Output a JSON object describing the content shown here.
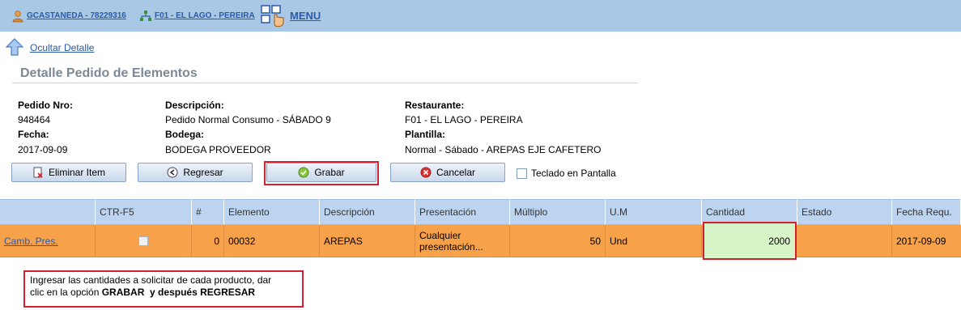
{
  "topbar": {
    "user_label": "GCASTANEDA - 78229316",
    "location_label": "F01 - EL LAGO - PEREIRA",
    "menu_label": "MENU"
  },
  "back": {
    "label": "Ocultar Detalle"
  },
  "section_title": "Detalle Pedido de Elementos",
  "details": {
    "pedido_label": "Pedido Nro:",
    "pedido_value": "948464",
    "fecha_label": "Fecha:",
    "fecha_value": "2017-09-09",
    "descripcion_label": "Descripción:",
    "descripcion_value": "Pedido Normal Consumo - SÁBADO 9",
    "bodega_label": "Bodega:",
    "bodega_value": "BODEGA PROVEEDOR",
    "restaurante_label": "Restaurante:",
    "restaurante_value": "F01 - EL LAGO - PEREIRA",
    "plantilla_label": "Plantilla:",
    "plantilla_value": "Normal - Sábado - AREPAS EJE CAFETERO"
  },
  "buttons": {
    "eliminar": "Eliminar Item",
    "regresar": "Regresar",
    "grabar": "Grabar",
    "cancelar": "Cancelar"
  },
  "teclado_label": "Teclado en Pantalla",
  "table": {
    "headers": [
      "",
      "CTR-F5",
      "#",
      "Elemento",
      "Descripción",
      "Presentación",
      "Múltiplo",
      "U.M",
      "Cantidad",
      "Estado",
      "Fecha Requ."
    ],
    "row": {
      "action": "Camb. Pres.",
      "index": "0",
      "elemento": "00032",
      "descripcion": "AREPAS",
      "presentacion_line1": "Cualquier",
      "presentacion_line2": "presentación...",
      "multiplo": "50",
      "um": "Und",
      "cantidad": "2000",
      "estado": "",
      "fecha": "2017-09-09"
    }
  },
  "note": {
    "line1": "Ingresar las cantidades a solicitar de cada producto, dar",
    "line2_prefix": "clic en la opción ",
    "line2_bold": "GRABAR  y después REGRESAR"
  },
  "colors": {
    "topbar": "#a9c8e6",
    "row_highlight": "#f7a24b",
    "cantidad_input": "#d6f4c8",
    "annotation_border": "#d3202f"
  }
}
